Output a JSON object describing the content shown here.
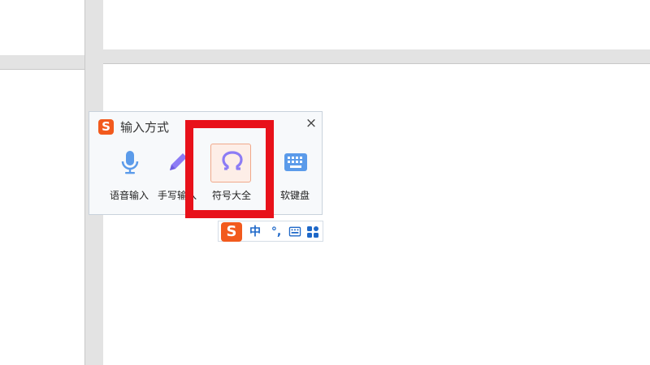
{
  "ime_panel": {
    "logo": "S",
    "title": "输入方式",
    "close_glyph": "×",
    "tools": [
      {
        "label": "语音输入",
        "icon": "microphone-icon"
      },
      {
        "label": "手写输入",
        "icon": "pen-icon"
      },
      {
        "label": "符号大全",
        "icon": "omega-icon"
      },
      {
        "label": "软键盘",
        "icon": "keyboard-icon"
      }
    ]
  },
  "status_bar": {
    "logo": "S",
    "mode": "中",
    "punct": "°,",
    "icons": [
      "keyboard-icon",
      "grid-icon"
    ]
  },
  "colors": {
    "accent_blue": "#5b9bea",
    "accent_purple": "#8c7cf5",
    "brand_orange": "#f25a1d",
    "highlight_red": "#e8111a"
  }
}
